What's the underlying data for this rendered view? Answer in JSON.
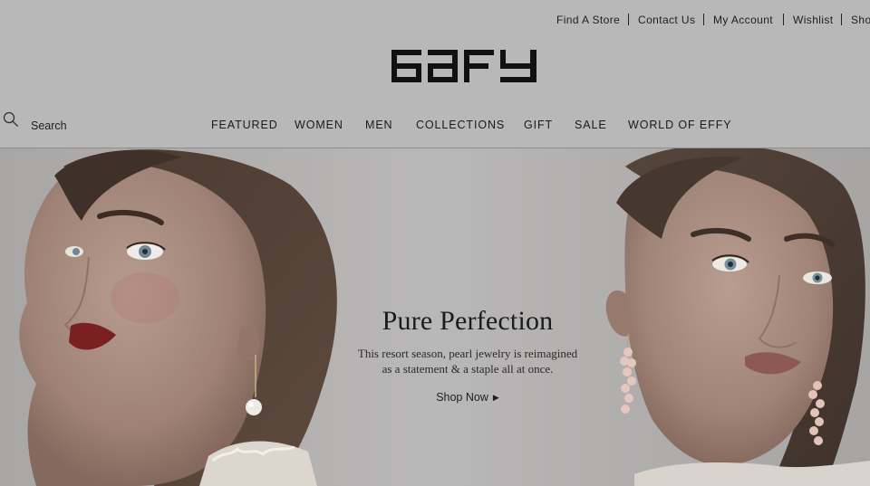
{
  "utility_nav": {
    "items": [
      "Find A Store",
      "Contact Us",
      "My Account",
      "Wishlist",
      "Sho"
    ]
  },
  "brand": {
    "logo_text": "EFFY"
  },
  "search": {
    "placeholder": "Search",
    "icon": "search-icon"
  },
  "main_nav": {
    "items": [
      "FEATURED",
      "WOMEN",
      "MEN",
      "COLLECTIONS",
      "GIFT",
      "SALE",
      "WORLD OF EFFY"
    ]
  },
  "hero": {
    "title": "Pure Perfection",
    "body_line1": "This resort season, pearl jewelry is reimagined",
    "body_line2": "as a statement & a staple all at once.",
    "cta_label": "Shop Now",
    "cta_icon": "play-arrow-icon"
  },
  "colors": {
    "overlay": "#b8b8b8",
    "text": "#1c1c1c"
  }
}
